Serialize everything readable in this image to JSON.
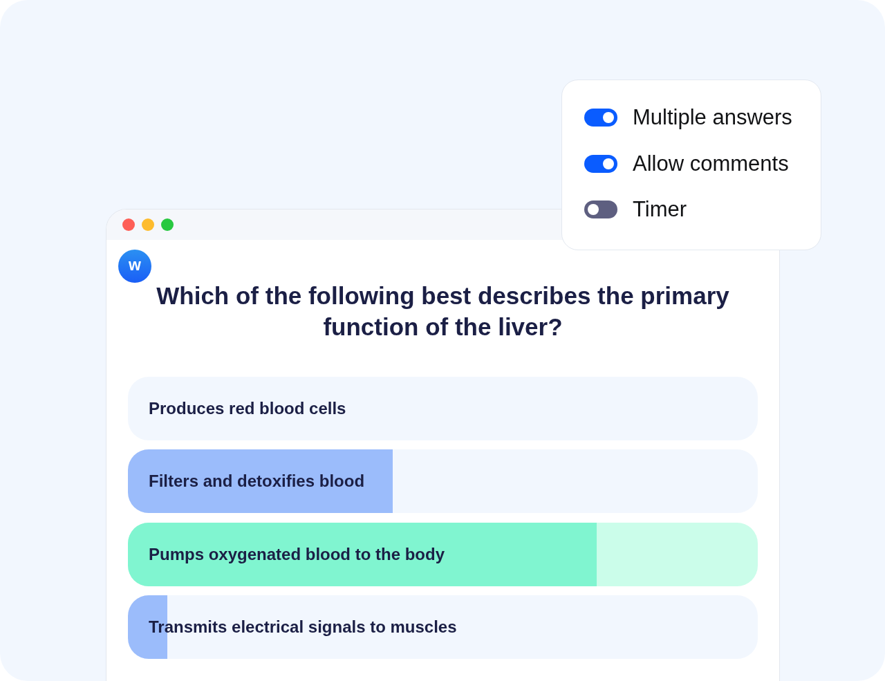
{
  "settings_panel": {
    "toggles": [
      {
        "label": "Multiple answers",
        "on": true
      },
      {
        "label": "Allow comments",
        "on": true
      },
      {
        "label": "Timer",
        "on": false
      }
    ]
  },
  "window": {
    "logo": "w",
    "question": "Which of the following best describes the primary function of the liver?",
    "options": [
      {
        "label": "Produces red blood cells",
        "selected": false
      },
      {
        "label": "Filters and detoxifies blood",
        "selected": false,
        "level": 0.42
      },
      {
        "label": "Pumps oxygenated blood to the body",
        "selected": true,
        "level": 0.744
      },
      {
        "label": "Transmits electrical signals to muscles",
        "selected": false,
        "level": 0.063
      }
    ]
  }
}
